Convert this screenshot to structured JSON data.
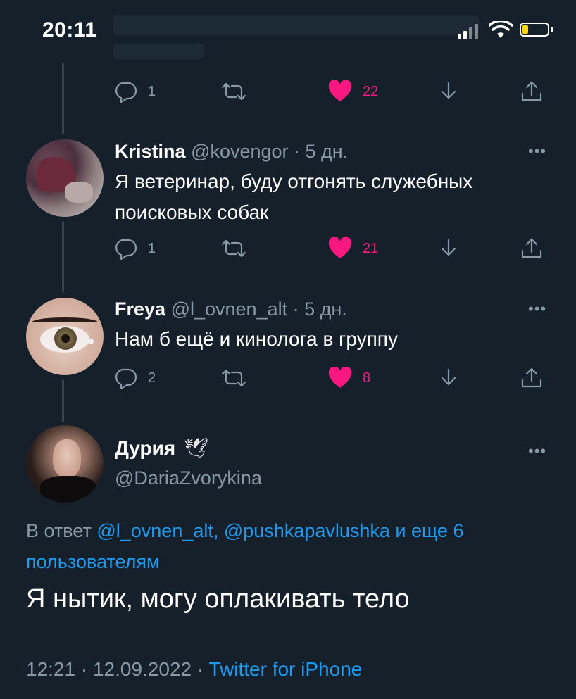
{
  "status_bar": {
    "time": "20:11",
    "battery_color": "#ffd60a"
  },
  "top_tweet": {
    "actions": {
      "replies": "1",
      "likes": "22"
    }
  },
  "replies": [
    {
      "name": "Kristina",
      "meta": "@kovengor · 5 дн.",
      "text": "Я ветеринар, буду отгонять служебных поисковых собак",
      "actions": {
        "replies": "1",
        "likes": "21"
      }
    },
    {
      "name": "Freya",
      "meta": "@l_ovnen_alt · 5 дн.",
      "text": "Нам б ещё и кинолога в группу",
      "actions": {
        "replies": "2",
        "likes": "8"
      }
    }
  ],
  "main_tweet": {
    "name": "Дурия",
    "name_emoji": "🕊",
    "handle": "@DariaZvorykina",
    "reply_prefix": "В ответ",
    "reply_users": "@l_ovnen_alt, @pushkapavlushka и еще 6 пользователям",
    "text": "Я нытик, могу оплакивать тело",
    "timestamp": "12:21 · 12.09.2022 · ",
    "source": "Twitter for iPhone"
  },
  "more_label": "•••",
  "colors": {
    "background": "#15202b",
    "accent": "#1d9bf0",
    "like": "#f91880",
    "muted": "#8899a6"
  }
}
